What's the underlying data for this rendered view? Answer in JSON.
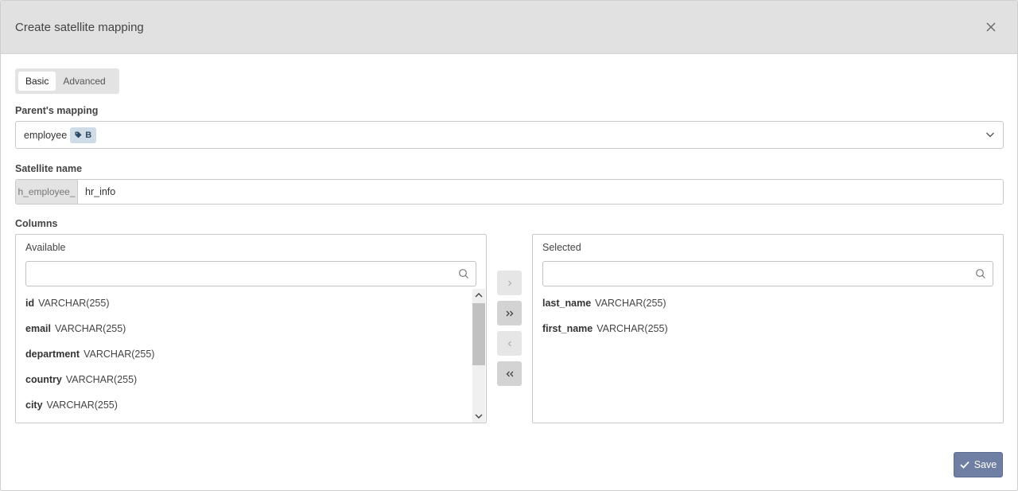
{
  "dialog": {
    "title": "Create satellite mapping"
  },
  "tabs": [
    {
      "label": "Basic"
    },
    {
      "label": "Advanced"
    }
  ],
  "parent_mapping": {
    "label": "Parent's mapping",
    "value": "employee",
    "badge": "B"
  },
  "satellite": {
    "label": "Satellite name",
    "prefix": "h_employee_",
    "value": "hr_info"
  },
  "columns": {
    "label": "Columns",
    "available": {
      "title": "Available",
      "search_value": "",
      "items": [
        {
          "name": "id",
          "type": "VARCHAR(255)"
        },
        {
          "name": "email",
          "type": "VARCHAR(255)"
        },
        {
          "name": "department",
          "type": "VARCHAR(255)"
        },
        {
          "name": "country",
          "type": "VARCHAR(255)"
        },
        {
          "name": "city",
          "type": "VARCHAR(255)"
        }
      ]
    },
    "selected": {
      "title": "Selected",
      "search_value": "",
      "items": [
        {
          "name": "last_name",
          "type": "VARCHAR(255)"
        },
        {
          "name": "first_name",
          "type": "VARCHAR(255)"
        }
      ]
    }
  },
  "actions": {
    "save_label": "Save"
  },
  "colors": {
    "header_bg": "#e1e1e1",
    "save_bg": "#6f7fa3",
    "badge_bg": "#cfdbe6"
  }
}
